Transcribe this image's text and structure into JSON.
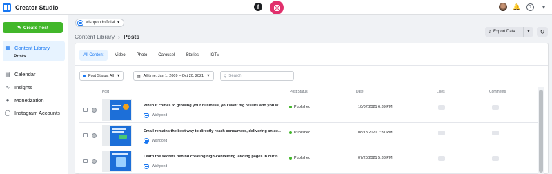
{
  "app": {
    "title": "Creator Studio"
  },
  "topbar": {
    "platforms": [
      {
        "name": "Facebook",
        "glyph": "f",
        "active": false
      },
      {
        "name": "Instagram",
        "active": true,
        "accent": "#e1306c"
      }
    ],
    "icons": [
      "bell-icon",
      "help-icon",
      "caret-down-icon"
    ]
  },
  "sidebar": {
    "create_label": "Create Post",
    "items": [
      {
        "label": "Content Library",
        "icon": "library-icon",
        "active": true,
        "sub": "Posts"
      },
      {
        "label": "Calendar",
        "icon": "calendar-icon"
      },
      {
        "label": "Insights",
        "icon": "insights-icon"
      },
      {
        "label": "Monetization",
        "icon": "monetization-icon"
      },
      {
        "label": "Instagram Accounts",
        "icon": "instagram-icon"
      }
    ]
  },
  "account": {
    "name": "wishpondofficial"
  },
  "breadcrumb": {
    "parent": "Content Library",
    "separator": "›",
    "current": "Posts"
  },
  "toolbar": {
    "export_label": "Export Data"
  },
  "tabs": [
    "All Content",
    "Video",
    "Photo",
    "Carousel",
    "Stories",
    "IGTV"
  ],
  "active_tab": "All Content",
  "filters": {
    "post_status": "Post Status: All",
    "date_range": "All time: Jan 1, 2009 – Oct 20, 2021",
    "search_placeholder": "Search"
  },
  "table": {
    "columns": [
      "Post",
      "Post Status",
      "Date",
      "Likes",
      "Comments"
    ],
    "rows": [
      {
        "title": "When it comes to growing your business, you want big results and you w...",
        "author": "Wishpond",
        "status": "Published",
        "date": "10/07/2021 6:39 PM"
      },
      {
        "title": "Email remains the best way to directly reach consumers, delivering an av...",
        "author": "Wishpond",
        "status": "Published",
        "date": "08/18/2021 7:31 PM"
      },
      {
        "title": "Learn the secrets behind creating high-converting landing pages in our n...",
        "author": "Wishpond",
        "status": "Published",
        "date": "07/20/2021 5:33 PM"
      }
    ]
  },
  "colors": {
    "brand": "#1877f2",
    "create": "#42b72a",
    "instagram": "#e1306c"
  }
}
